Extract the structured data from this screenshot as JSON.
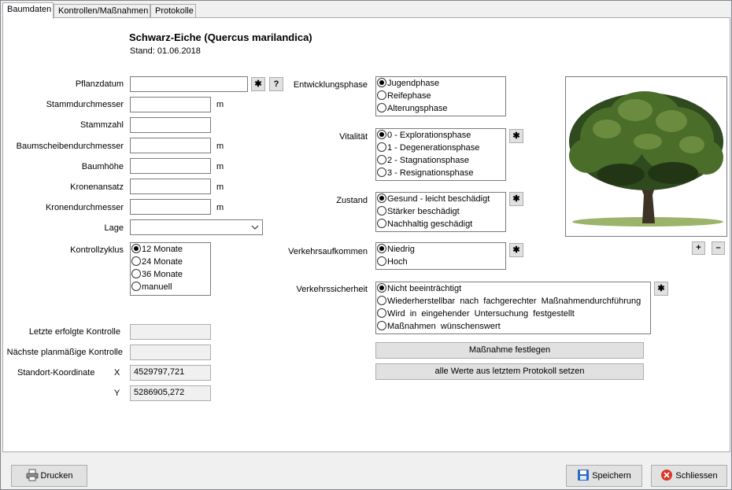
{
  "tabs": [
    {
      "label": "Baumdaten"
    },
    {
      "label": "Kontrollen/Maßnahmen"
    },
    {
      "label": "Protokolle"
    }
  ],
  "header": {
    "title": "Schwarz-Eiche  (Quercus marilandica)",
    "stand": "Stand: 01.06.2018"
  },
  "left": {
    "pflanzdatum": {
      "label": "Pflanzdatum",
      "value": ""
    },
    "stammdurchmesser": {
      "label": "Stammdurchmesser",
      "value": "",
      "unit": "m"
    },
    "stammzahl": {
      "label": "Stammzahl",
      "value": ""
    },
    "baumscheibe": {
      "label": "Baumscheibendurchmesser",
      "value": "",
      "unit": "m"
    },
    "baumhoehe": {
      "label": "Baumhöhe",
      "value": "",
      "unit": "m"
    },
    "kronenansatz": {
      "label": "Kronenansatz",
      "value": "",
      "unit": "m"
    },
    "kronendurchmesser": {
      "label": "Kronendurchmesser",
      "value": "",
      "unit": "m"
    },
    "lage": {
      "label": "Lage",
      "value": ""
    },
    "kontrollzyklus": {
      "label": "Kontrollzyklus",
      "options": [
        "12 Monate",
        "24 Monate",
        "36 Monate",
        "manuell"
      ],
      "selected": 0
    },
    "letzte_kontrolle": {
      "label": "Letzte erfolgte Kontrolle",
      "value": ""
    },
    "naechste_kontrolle": {
      "label": "Nächste planmäßige Kontrolle",
      "value": ""
    },
    "koordinate": {
      "label": "Standort-Koordinate",
      "x_label": "X",
      "x_value": "4529797,721",
      "y_label": "Y",
      "y_value": "5286905,272"
    }
  },
  "star": "✱",
  "help": "?",
  "middle": {
    "entwicklungsphase": {
      "label": "Entwicklungsphase",
      "options": [
        "Jugendphase",
        "Reifephase",
        "Alterungsphase"
      ],
      "selected": 0
    },
    "vitalitaet": {
      "label": "Vitalität",
      "options": [
        "0 - Explorationsphase",
        "1 - Degenerationsphase",
        "2 - Stagnationsphase",
        "3 - Resignationsphase"
      ],
      "selected": 0
    },
    "zustand": {
      "label": "Zustand",
      "options": [
        "Gesund - leicht beschädigt",
        "Stärker beschädigt",
        "Nachhaltig geschädigt"
      ],
      "selected": 0
    },
    "verkehrsaufkommen": {
      "label": "Verkehrsaufkommen",
      "options": [
        "Niedrig",
        "Hoch"
      ],
      "selected": 0
    },
    "verkehrssicherheit": {
      "label": "Verkehrssicherheit",
      "options": [
        "Nicht beeinträchtigt",
        "Wiederherstellbar  nach  fachgerechter  Maßnahmendurchführung",
        "Wird  in  eingehender  Untersuchung  festgestellt",
        "Maßnahmen  wünschenswert"
      ],
      "selected": 0
    },
    "massnahme_button": "Maßnahme festlegen",
    "alle_werte_button": "alle Werte aus letztem Protokoll setzen"
  },
  "image_controls": {
    "plus": "+",
    "minus": "–"
  },
  "footer": {
    "drucken": "Drucken",
    "speichern": "Speichern",
    "schliessen": "Schliessen"
  },
  "colors": {
    "panel_bg": "#ffffff",
    "window_bg": "#f0f0f0",
    "close_red": "#d9382a",
    "save_blue": "#2a6cc4"
  }
}
